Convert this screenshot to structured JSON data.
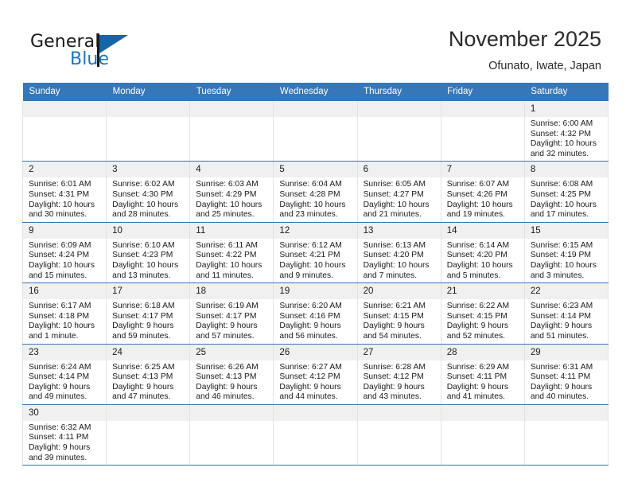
{
  "brand": {
    "name_top": "General",
    "name_bottom": "Blue",
    "accent_color": "#1e72bb",
    "flag_color": "#1565a8"
  },
  "header": {
    "month_title": "November 2025",
    "location": "Ofunato, Iwate, Japan"
  },
  "theme": {
    "header_row_bg": "#3577b8",
    "daynum_bg": "#f0f0f0",
    "cell_bg": "#ffffff",
    "row_divider": "#3577b8"
  },
  "weekdays": [
    "Sunday",
    "Monday",
    "Tuesday",
    "Wednesday",
    "Thursday",
    "Friday",
    "Saturday"
  ],
  "weeks": [
    [
      {
        "day": "",
        "empty": true
      },
      {
        "day": "",
        "empty": true
      },
      {
        "day": "",
        "empty": true
      },
      {
        "day": "",
        "empty": true
      },
      {
        "day": "",
        "empty": true
      },
      {
        "day": "",
        "empty": true
      },
      {
        "day": "1",
        "sunrise": "Sunrise: 6:00 AM",
        "sunset": "Sunset: 4:32 PM",
        "daylight1": "Daylight: 10 hours",
        "daylight2": "and 32 minutes."
      }
    ],
    [
      {
        "day": "2",
        "sunrise": "Sunrise: 6:01 AM",
        "sunset": "Sunset: 4:31 PM",
        "daylight1": "Daylight: 10 hours",
        "daylight2": "and 30 minutes."
      },
      {
        "day": "3",
        "sunrise": "Sunrise: 6:02 AM",
        "sunset": "Sunset: 4:30 PM",
        "daylight1": "Daylight: 10 hours",
        "daylight2": "and 28 minutes."
      },
      {
        "day": "4",
        "sunrise": "Sunrise: 6:03 AM",
        "sunset": "Sunset: 4:29 PM",
        "daylight1": "Daylight: 10 hours",
        "daylight2": "and 25 minutes."
      },
      {
        "day": "5",
        "sunrise": "Sunrise: 6:04 AM",
        "sunset": "Sunset: 4:28 PM",
        "daylight1": "Daylight: 10 hours",
        "daylight2": "and 23 minutes."
      },
      {
        "day": "6",
        "sunrise": "Sunrise: 6:05 AM",
        "sunset": "Sunset: 4:27 PM",
        "daylight1": "Daylight: 10 hours",
        "daylight2": "and 21 minutes."
      },
      {
        "day": "7",
        "sunrise": "Sunrise: 6:07 AM",
        "sunset": "Sunset: 4:26 PM",
        "daylight1": "Daylight: 10 hours",
        "daylight2": "and 19 minutes."
      },
      {
        "day": "8",
        "sunrise": "Sunrise: 6:08 AM",
        "sunset": "Sunset: 4:25 PM",
        "daylight1": "Daylight: 10 hours",
        "daylight2": "and 17 minutes."
      }
    ],
    [
      {
        "day": "9",
        "sunrise": "Sunrise: 6:09 AM",
        "sunset": "Sunset: 4:24 PM",
        "daylight1": "Daylight: 10 hours",
        "daylight2": "and 15 minutes."
      },
      {
        "day": "10",
        "sunrise": "Sunrise: 6:10 AM",
        "sunset": "Sunset: 4:23 PM",
        "daylight1": "Daylight: 10 hours",
        "daylight2": "and 13 minutes."
      },
      {
        "day": "11",
        "sunrise": "Sunrise: 6:11 AM",
        "sunset": "Sunset: 4:22 PM",
        "daylight1": "Daylight: 10 hours",
        "daylight2": "and 11 minutes."
      },
      {
        "day": "12",
        "sunrise": "Sunrise: 6:12 AM",
        "sunset": "Sunset: 4:21 PM",
        "daylight1": "Daylight: 10 hours",
        "daylight2": "and 9 minutes."
      },
      {
        "day": "13",
        "sunrise": "Sunrise: 6:13 AM",
        "sunset": "Sunset: 4:20 PM",
        "daylight1": "Daylight: 10 hours",
        "daylight2": "and 7 minutes."
      },
      {
        "day": "14",
        "sunrise": "Sunrise: 6:14 AM",
        "sunset": "Sunset: 4:20 PM",
        "daylight1": "Daylight: 10 hours",
        "daylight2": "and 5 minutes."
      },
      {
        "day": "15",
        "sunrise": "Sunrise: 6:15 AM",
        "sunset": "Sunset: 4:19 PM",
        "daylight1": "Daylight: 10 hours",
        "daylight2": "and 3 minutes."
      }
    ],
    [
      {
        "day": "16",
        "sunrise": "Sunrise: 6:17 AM",
        "sunset": "Sunset: 4:18 PM",
        "daylight1": "Daylight: 10 hours",
        "daylight2": "and 1 minute."
      },
      {
        "day": "17",
        "sunrise": "Sunrise: 6:18 AM",
        "sunset": "Sunset: 4:17 PM",
        "daylight1": "Daylight: 9 hours",
        "daylight2": "and 59 minutes."
      },
      {
        "day": "18",
        "sunrise": "Sunrise: 6:19 AM",
        "sunset": "Sunset: 4:17 PM",
        "daylight1": "Daylight: 9 hours",
        "daylight2": "and 57 minutes."
      },
      {
        "day": "19",
        "sunrise": "Sunrise: 6:20 AM",
        "sunset": "Sunset: 4:16 PM",
        "daylight1": "Daylight: 9 hours",
        "daylight2": "and 56 minutes."
      },
      {
        "day": "20",
        "sunrise": "Sunrise: 6:21 AM",
        "sunset": "Sunset: 4:15 PM",
        "daylight1": "Daylight: 9 hours",
        "daylight2": "and 54 minutes."
      },
      {
        "day": "21",
        "sunrise": "Sunrise: 6:22 AM",
        "sunset": "Sunset: 4:15 PM",
        "daylight1": "Daylight: 9 hours",
        "daylight2": "and 52 minutes."
      },
      {
        "day": "22",
        "sunrise": "Sunrise: 6:23 AM",
        "sunset": "Sunset: 4:14 PM",
        "daylight1": "Daylight: 9 hours",
        "daylight2": "and 51 minutes."
      }
    ],
    [
      {
        "day": "23",
        "sunrise": "Sunrise: 6:24 AM",
        "sunset": "Sunset: 4:14 PM",
        "daylight1": "Daylight: 9 hours",
        "daylight2": "and 49 minutes."
      },
      {
        "day": "24",
        "sunrise": "Sunrise: 6:25 AM",
        "sunset": "Sunset: 4:13 PM",
        "daylight1": "Daylight: 9 hours",
        "daylight2": "and 47 minutes."
      },
      {
        "day": "25",
        "sunrise": "Sunrise: 6:26 AM",
        "sunset": "Sunset: 4:13 PM",
        "daylight1": "Daylight: 9 hours",
        "daylight2": "and 46 minutes."
      },
      {
        "day": "26",
        "sunrise": "Sunrise: 6:27 AM",
        "sunset": "Sunset: 4:12 PM",
        "daylight1": "Daylight: 9 hours",
        "daylight2": "and 44 minutes."
      },
      {
        "day": "27",
        "sunrise": "Sunrise: 6:28 AM",
        "sunset": "Sunset: 4:12 PM",
        "daylight1": "Daylight: 9 hours",
        "daylight2": "and 43 minutes."
      },
      {
        "day": "28",
        "sunrise": "Sunrise: 6:29 AM",
        "sunset": "Sunset: 4:11 PM",
        "daylight1": "Daylight: 9 hours",
        "daylight2": "and 41 minutes."
      },
      {
        "day": "29",
        "sunrise": "Sunrise: 6:31 AM",
        "sunset": "Sunset: 4:11 PM",
        "daylight1": "Daylight: 9 hours",
        "daylight2": "and 40 minutes."
      }
    ],
    [
      {
        "day": "30",
        "sunrise": "Sunrise: 6:32 AM",
        "sunset": "Sunset: 4:11 PM",
        "daylight1": "Daylight: 9 hours",
        "daylight2": "and 39 minutes."
      },
      {
        "day": "",
        "empty": true
      },
      {
        "day": "",
        "empty": true
      },
      {
        "day": "",
        "empty": true
      },
      {
        "day": "",
        "empty": true
      },
      {
        "day": "",
        "empty": true
      },
      {
        "day": "",
        "empty": true
      }
    ]
  ]
}
